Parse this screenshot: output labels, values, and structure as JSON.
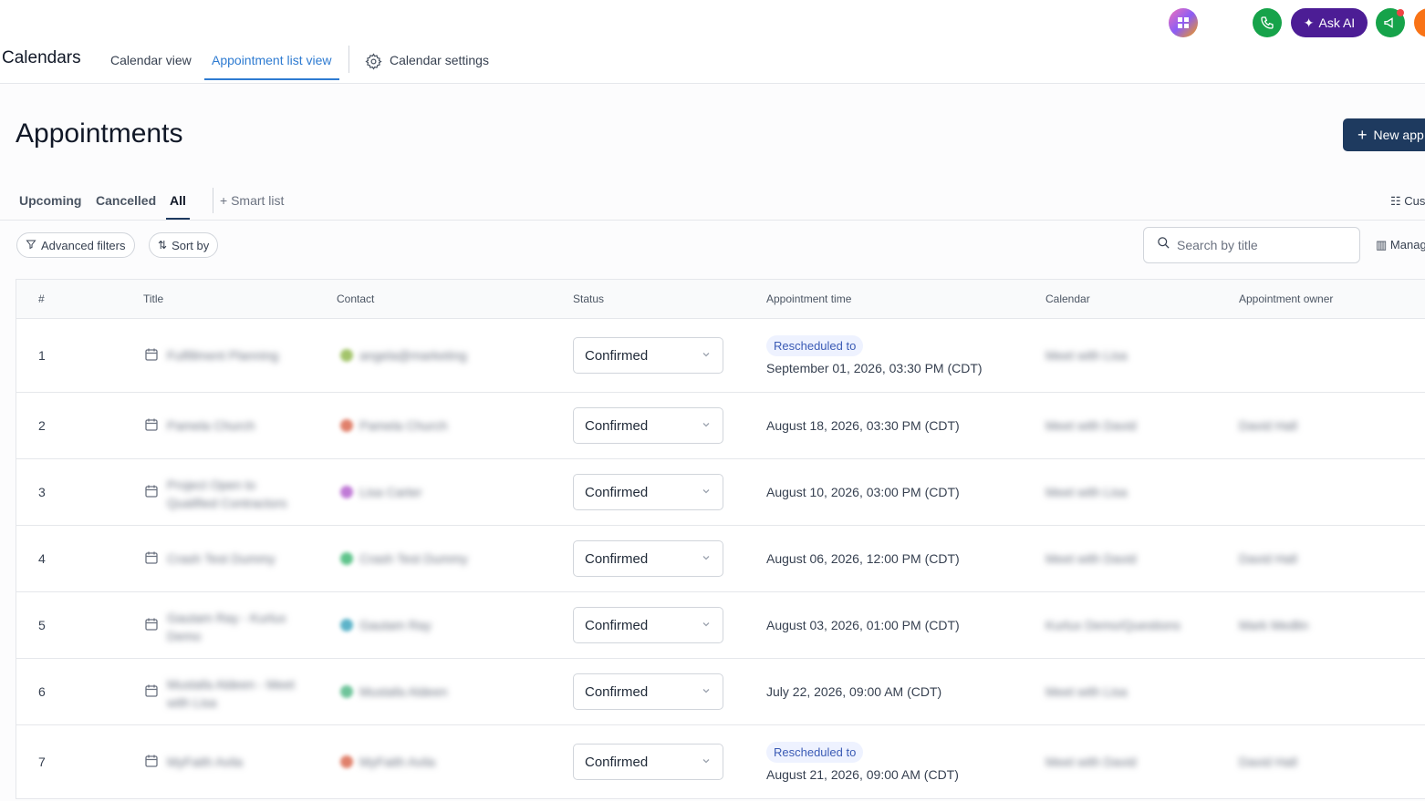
{
  "header": {
    "app_title": "Calendars",
    "tabs": [
      {
        "label": "Calendar view"
      },
      {
        "label": "Appointment list view"
      },
      {
        "label": "Calendar settings"
      }
    ],
    "ask_ai_label": "Ask AI",
    "accent_color": "#2e7bd1"
  },
  "page": {
    "title": "Appointments",
    "new_button_label": "New app"
  },
  "filter_tabs": {
    "upcoming": "Upcoming",
    "cancelled": "Cancelled",
    "all": "All",
    "smart_list": "Smart list",
    "customize": "Cus"
  },
  "toolbar": {
    "advanced_filters": "Advanced filters",
    "sort_by": "Sort by",
    "search_placeholder": "Search by title",
    "manage": "Manag"
  },
  "table": {
    "columns": {
      "num": "#",
      "title": "Title",
      "contact": "Contact",
      "status": "Status",
      "time": "Appointment time",
      "calendar": "Calendar",
      "owner": "Appointment owner"
    },
    "rows": [
      {
        "num": "1",
        "title": "Fulfillment Planning",
        "contact": "angela@marketing",
        "status": "Confirmed",
        "rescheduled": "Rescheduled to",
        "time": "September 01, 2026, 03:30 PM (CDT)",
        "calendar": "Meet with Lisa",
        "owner": ""
      },
      {
        "num": "2",
        "title": "Pamela Church",
        "contact": "Pamela Church",
        "status": "Confirmed",
        "rescheduled": "",
        "time": "August 18, 2026, 03:30 PM (CDT)",
        "calendar": "Meet with David",
        "owner": "David Hall"
      },
      {
        "num": "3",
        "title": "Project Open to Qualified Contractors",
        "contact": "Lisa Carter",
        "status": "Confirmed",
        "rescheduled": "",
        "time": "August 10, 2026, 03:00 PM (CDT)",
        "calendar": "Meet with Lisa",
        "owner": ""
      },
      {
        "num": "4",
        "title": "Crash Test Dummy",
        "contact": "Crash Test Dummy",
        "status": "Confirmed",
        "rescheduled": "",
        "time": "August 06, 2026, 12:00 PM (CDT)",
        "calendar": "Meet with David",
        "owner": "David Hall"
      },
      {
        "num": "5",
        "title": "Gautam Ray - Kurlux Demo",
        "contact": "Gautam Ray",
        "status": "Confirmed",
        "rescheduled": "",
        "time": "August 03, 2026, 01:00 PM (CDT)",
        "calendar": "Kurlux Demo/Questions",
        "owner": "Mark Medlin"
      },
      {
        "num": "6",
        "title": "Mustafa Aldeen - Meet with Lisa",
        "contact": "Mustafa Aldeen",
        "status": "Confirmed",
        "rescheduled": "",
        "time": "July 22, 2026, 09:00 AM (CDT)",
        "calendar": "Meet with Lisa",
        "owner": ""
      },
      {
        "num": "7",
        "title": "MyFaith Avila",
        "contact": "MyFaith Avila",
        "status": "Confirmed",
        "rescheduled": "Rescheduled to",
        "time": "August 21, 2026, 09:00 AM (CDT)",
        "calendar": "Meet with David",
        "owner": "David Hall"
      }
    ],
    "contact_colors": [
      "#a3c46b",
      "#e0806b",
      "#c07ad6",
      "#5fc48b",
      "#5db3c9",
      "#6ec49a",
      "#e0806b"
    ]
  }
}
